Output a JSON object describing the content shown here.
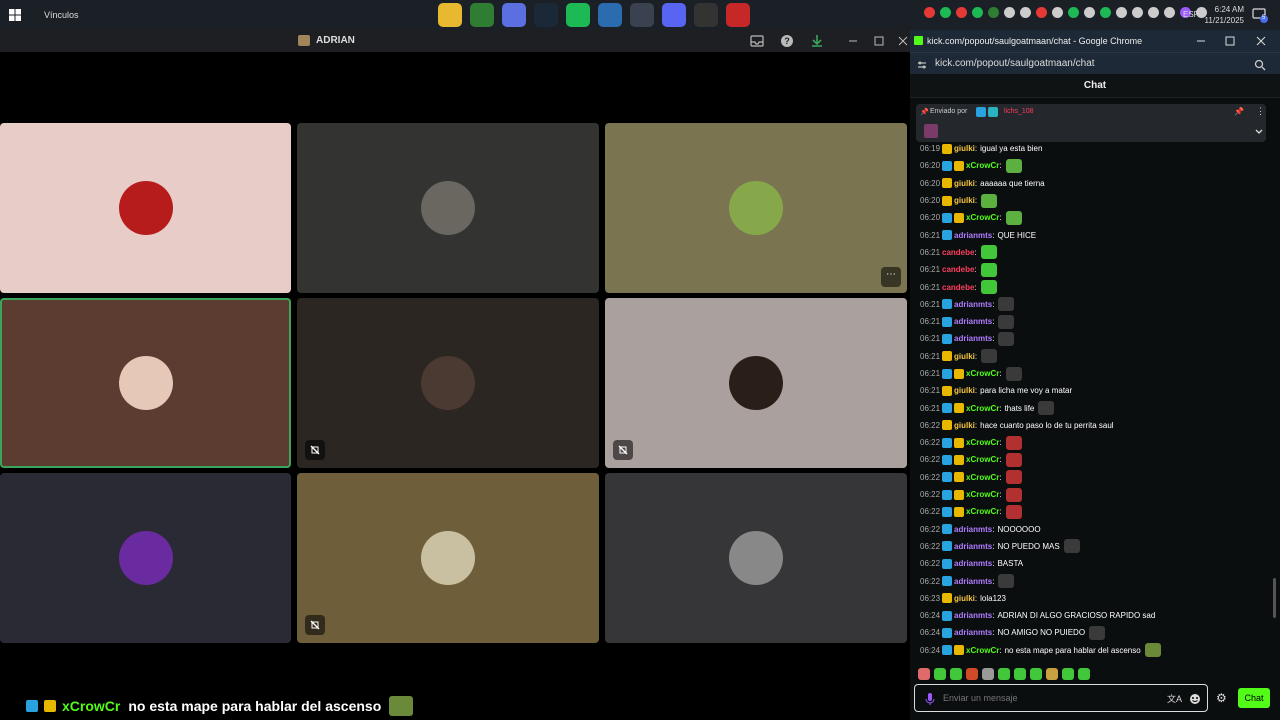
{
  "taskbar": {
    "links_label": "Vínculos",
    "lang": "ESP",
    "time": "6:24 AM",
    "date": "11/21/2025",
    "notif_count": "5",
    "apps": [
      {
        "icon": "file-explorer-icon",
        "color": "#e8b830"
      },
      {
        "icon": "chrome-icon",
        "color": "#2e7d32"
      },
      {
        "icon": "copilot-icon",
        "color": "#5b6fe0"
      },
      {
        "icon": "steam-icon",
        "color": "#1b2838"
      },
      {
        "icon": "spotify-icon",
        "color": "#1db954"
      },
      {
        "icon": "store-icon",
        "color": "#2b6cb0"
      },
      {
        "icon": "app-icon",
        "color": "#3a4250"
      },
      {
        "icon": "discord-icon",
        "color": "#5865f2"
      },
      {
        "icon": "obs-icon",
        "color": "#333"
      },
      {
        "icon": "chrome-alt-icon",
        "color": "#c62828"
      }
    ]
  },
  "discord": {
    "title": "ADRIAN",
    "tiles": [
      {
        "bg": "#e8ccc8",
        "avatar": "#b71c1c",
        "muted": false,
        "more": false,
        "active": false
      },
      {
        "bg": "#333331",
        "avatar": "#6a6660",
        "muted": false,
        "more": false,
        "active": false
      },
      {
        "bg": "#7a7550",
        "avatar": "#86a84a",
        "muted": false,
        "more": true,
        "active": false
      },
      {
        "bg": "#5c3c30",
        "avatar": "#e6c8b8",
        "muted": false,
        "more": false,
        "active": true
      },
      {
        "bg": "#2b2622",
        "avatar": "#4a3a32",
        "muted": true,
        "more": false,
        "active": false
      },
      {
        "bg": "#aaa09e",
        "avatar": "#2a1e18",
        "muted": true,
        "more": false,
        "active": false
      },
      {
        "bg": "#2a2a34",
        "avatar": "#6a2aa0",
        "muted": false,
        "more": false,
        "active": false
      },
      {
        "bg": "#6f5e3a",
        "avatar": "#c8c0a0",
        "muted": true,
        "more": false,
        "active": false
      },
      {
        "bg": "#363638",
        "avatar": "#888",
        "muted": false,
        "more": false,
        "active": false
      }
    ],
    "overlay": {
      "user": "xCrowCr",
      "text": "no esta mape para hablar del ascenso"
    }
  },
  "chrome": {
    "title": "kick.com/popout/saulgoatmaan/chat - Google Chrome",
    "url": "kick.com/popout/saulgoatmaan/chat"
  },
  "chat": {
    "header": "Chat",
    "pinned_label": "Enviado por",
    "pinned_user": "lichs_108",
    "input_placeholder": "Enviar un mensaje",
    "send_label": "Chat",
    "messages": [
      {
        "time": "06:19",
        "user": "giulki",
        "color": "#f5c542",
        "text": "igual ya esta bien",
        "badges": [
          "#e8b800"
        ],
        "emotes": []
      },
      {
        "time": "06:20",
        "user": "xCrowCr",
        "color": "#53fc18",
        "text": "",
        "badges": [
          "#29a3e0",
          "#e8b800"
        ],
        "emotes": [
          "#5cb040"
        ]
      },
      {
        "time": "06:20",
        "user": "giulki",
        "color": "#f5c542",
        "text": "aaaaaa que tierna",
        "badges": [
          "#e8b800"
        ],
        "emotes": []
      },
      {
        "time": "06:20",
        "user": "giulki",
        "color": "#f5c542",
        "text": "",
        "badges": [
          "#e8b800"
        ],
        "emotes": [
          "#5cb040"
        ]
      },
      {
        "time": "06:20",
        "user": "xCrowCr",
        "color": "#53fc18",
        "text": "",
        "badges": [
          "#29a3e0",
          "#e8b800"
        ],
        "emotes": [
          "#5cb040"
        ]
      },
      {
        "time": "06:21",
        "user": "adrianmts",
        "color": "#b07cff",
        "text": "QUE HICE",
        "badges": [
          "#29a3e0"
        ],
        "emotes": []
      },
      {
        "time": "06:21",
        "user": "candebe",
        "color": "#ff3d5f",
        "text": "",
        "badges": [],
        "emotes": [
          "#43c73a"
        ]
      },
      {
        "time": "06:21",
        "user": "candebe",
        "color": "#ff3d5f",
        "text": "",
        "badges": [],
        "emotes": [
          "#43c73a"
        ]
      },
      {
        "time": "06:21",
        "user": "candebe",
        "color": "#ff3d5f",
        "text": "",
        "badges": [],
        "emotes": [
          "#43c73a"
        ]
      },
      {
        "time": "06:21",
        "user": "adrianmts",
        "color": "#b07cff",
        "text": "",
        "badges": [
          "#29a3e0"
        ],
        "emotes": [
          "#3a3a3a"
        ]
      },
      {
        "time": "06:21",
        "user": "adrianmts",
        "color": "#b07cff",
        "text": "",
        "badges": [
          "#29a3e0"
        ],
        "emotes": [
          "#3a3a3a"
        ]
      },
      {
        "time": "06:21",
        "user": "adrianmts",
        "color": "#b07cff",
        "text": "",
        "badges": [
          "#29a3e0"
        ],
        "emotes": [
          "#3a3a3a"
        ]
      },
      {
        "time": "06:21",
        "user": "giulki",
        "color": "#f5c542",
        "text": "",
        "badges": [
          "#e8b800"
        ],
        "emotes": [
          "#3a3a3a"
        ]
      },
      {
        "time": "06:21",
        "user": "xCrowCr",
        "color": "#53fc18",
        "text": "",
        "badges": [
          "#29a3e0",
          "#e8b800"
        ],
        "emotes": [
          "#3a3a3a"
        ]
      },
      {
        "time": "06:21",
        "user": "giulki",
        "color": "#f5c542",
        "text": "para licha me voy a matar",
        "badges": [
          "#e8b800"
        ],
        "emotes": []
      },
      {
        "time": "06:21",
        "user": "xCrowCr",
        "color": "#53fc18",
        "text": "thats life",
        "badges": [
          "#29a3e0",
          "#e8b800"
        ],
        "emotes": [
          "#3a3a3a"
        ]
      },
      {
        "time": "06:22",
        "user": "giulki",
        "color": "#f5c542",
        "text": "hace cuanto paso lo de tu perrita saul",
        "badges": [
          "#e8b800"
        ],
        "emotes": []
      },
      {
        "time": "06:22",
        "user": "xCrowCr",
        "color": "#53fc18",
        "text": "",
        "badges": [
          "#29a3e0",
          "#e8b800"
        ],
        "emotes": [
          "#b33030"
        ]
      },
      {
        "time": "06:22",
        "user": "xCrowCr",
        "color": "#53fc18",
        "text": "",
        "badges": [
          "#29a3e0",
          "#e8b800"
        ],
        "emotes": [
          "#b33030"
        ]
      },
      {
        "time": "06:22",
        "user": "xCrowCr",
        "color": "#53fc18",
        "text": "",
        "badges": [
          "#29a3e0",
          "#e8b800"
        ],
        "emotes": [
          "#b33030"
        ]
      },
      {
        "time": "06:22",
        "user": "xCrowCr",
        "color": "#53fc18",
        "text": "",
        "badges": [
          "#29a3e0",
          "#e8b800"
        ],
        "emotes": [
          "#b33030"
        ]
      },
      {
        "time": "06:22",
        "user": "xCrowCr",
        "color": "#53fc18",
        "text": "",
        "badges": [
          "#29a3e0",
          "#e8b800"
        ],
        "emotes": [
          "#b33030"
        ]
      },
      {
        "time": "06:22",
        "user": "adrianmts",
        "color": "#b07cff",
        "text": "NOOOOOO",
        "badges": [
          "#29a3e0"
        ],
        "emotes": []
      },
      {
        "time": "06:22",
        "user": "adrianmts",
        "color": "#b07cff",
        "text": "NO PUEDO MAS",
        "badges": [
          "#29a3e0"
        ],
        "emotes": [
          "#3a3a3a"
        ]
      },
      {
        "time": "06:22",
        "user": "adrianmts",
        "color": "#b07cff",
        "text": "BASTA",
        "badges": [
          "#29a3e0"
        ],
        "emotes": []
      },
      {
        "time": "06:22",
        "user": "adrianmts",
        "color": "#b07cff",
        "text": "",
        "badges": [
          "#29a3e0"
        ],
        "emotes": [
          "#3a3a3a"
        ]
      },
      {
        "time": "06:23",
        "user": "giulki",
        "color": "#f5c542",
        "text": "lola123",
        "badges": [
          "#e8b800"
        ],
        "emotes": []
      },
      {
        "time": "06:24",
        "user": "adrianmts",
        "color": "#b07cff",
        "text": "ADRIAN DI ALGO GRACIOSO RAPIDO sad",
        "badges": [
          "#29a3e0"
        ],
        "emotes": []
      },
      {
        "time": "06:24",
        "user": "adrianmts",
        "color": "#b07cff",
        "text": "NO AMIGO NO PUIEDO",
        "badges": [
          "#29a3e0"
        ],
        "emotes": [
          "#3a3a3a"
        ]
      },
      {
        "time": "06:24",
        "user": "xCrowCr",
        "color": "#53fc18",
        "text": "no esta mape para hablar del ascenso",
        "badges": [
          "#29a3e0",
          "#e8b800"
        ],
        "emotes": [
          "#6a8a3a"
        ]
      }
    ],
    "emote_bar": [
      "#e06a6a",
      "#43c73a",
      "#43c73a",
      "#d04a2a",
      "#999",
      "#43c73a",
      "#43c73a",
      "#43c73a",
      "#c8a040",
      "#43c73a",
      "#43c73a"
    ]
  }
}
